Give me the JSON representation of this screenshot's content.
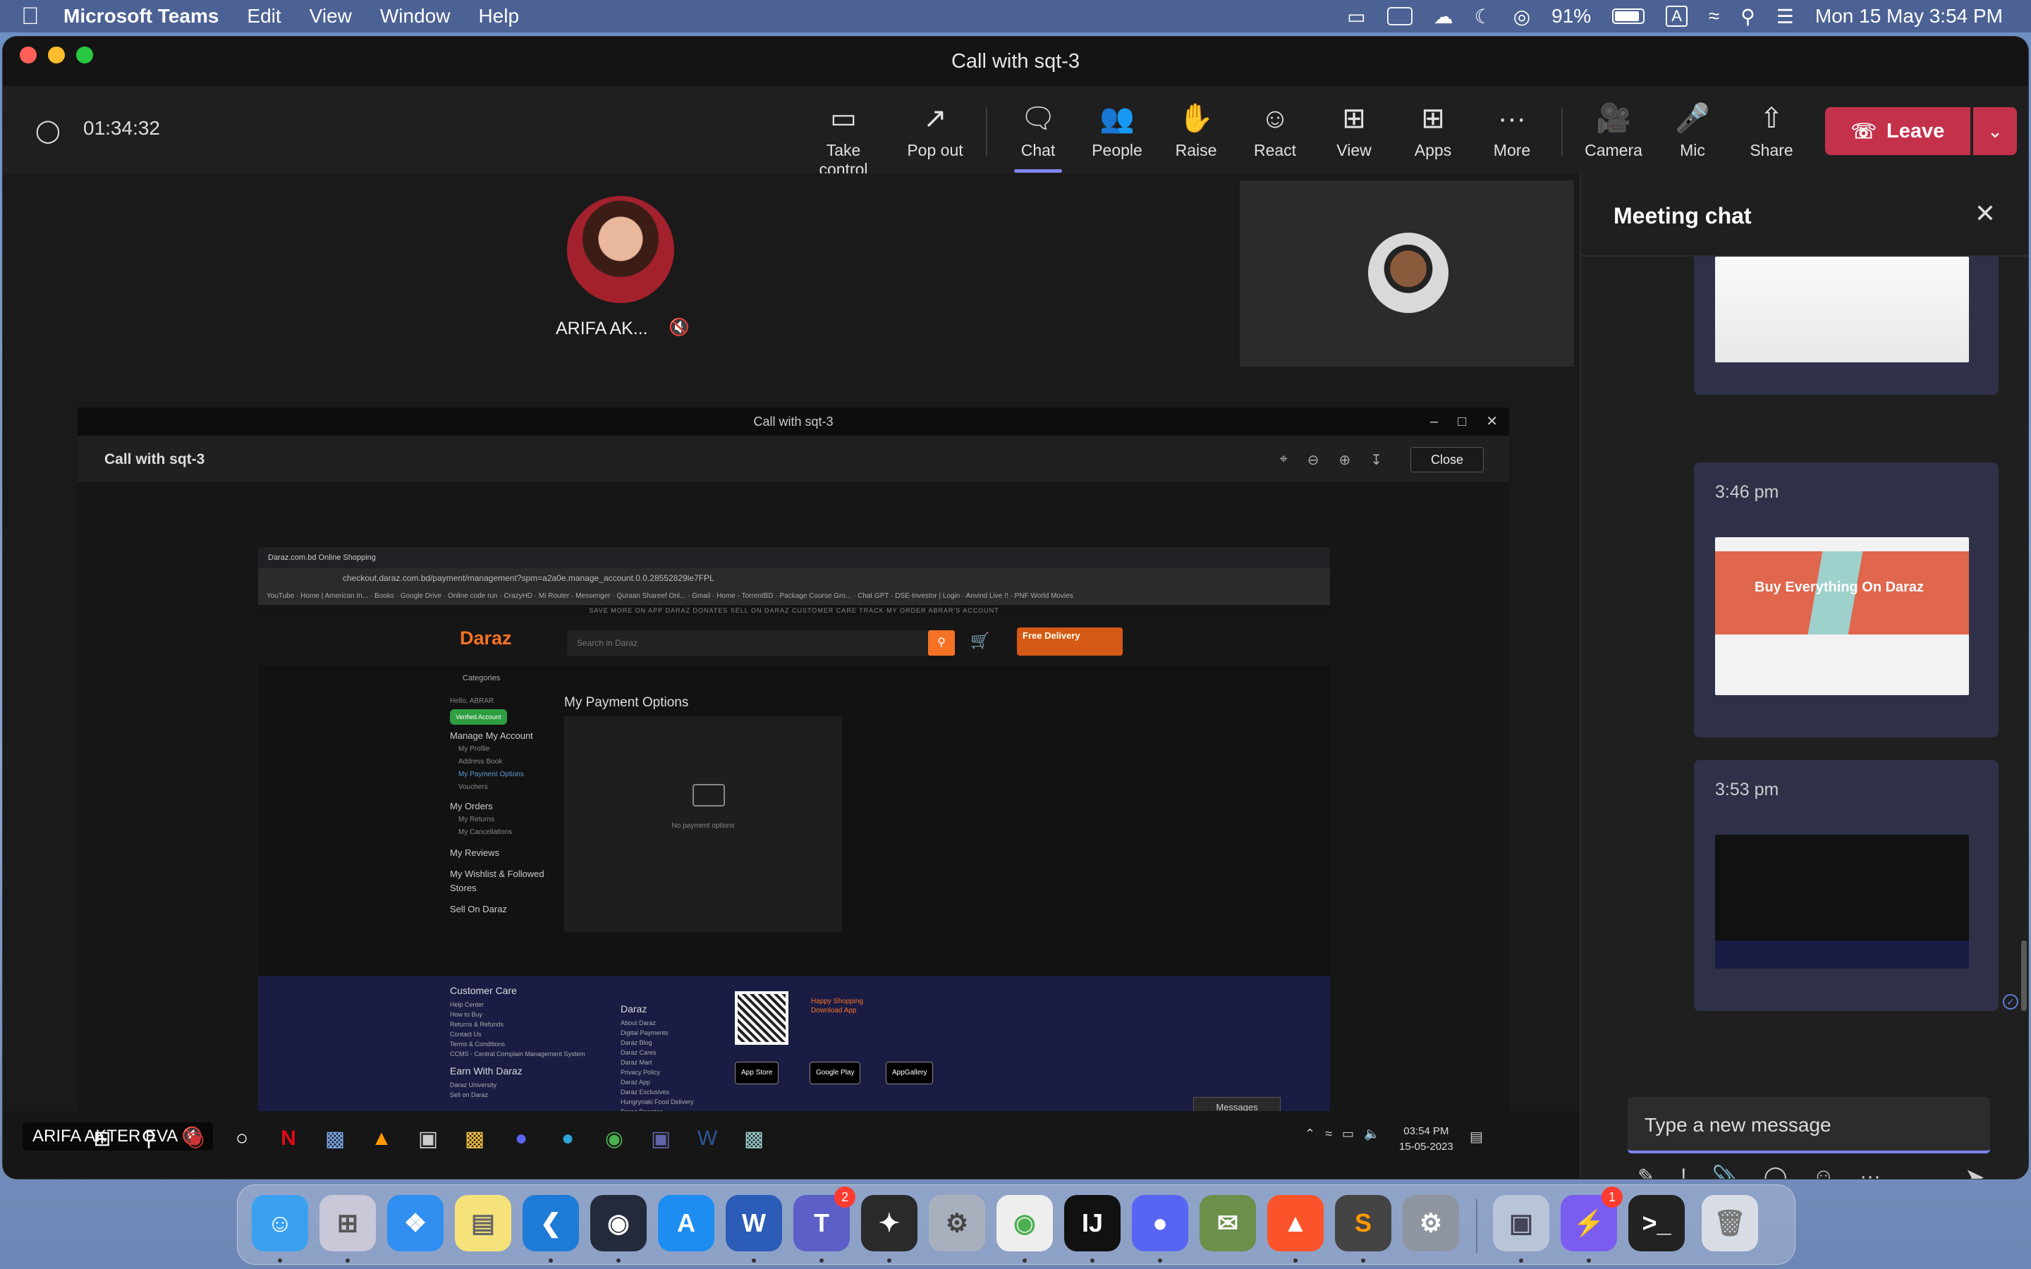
{
  "menubar": {
    "app_name": "Microsoft Teams",
    "menus": [
      "Edit",
      "View",
      "Window",
      "Help"
    ],
    "battery": "91%",
    "datetime": "Mon 15 May  3:54 PM"
  },
  "window": {
    "title": "Call with sqt-3",
    "timer": "01:34:32"
  },
  "toolbar": {
    "take_control": "Take control",
    "pop_out": "Pop out",
    "chat": "Chat",
    "people": "People",
    "raise": "Raise",
    "react": "React",
    "view": "View",
    "apps": "Apps",
    "more": "More",
    "camera": "Camera",
    "mic": "Mic",
    "share": "Share",
    "leave": "Leave"
  },
  "participants": {
    "p1_name": "ARIFA AK...",
    "presenter_name": "ARIFA AKTER EVA"
  },
  "shared_screen": {
    "window_title": "Call with sqt-3",
    "viewer_title": "Call with sqt-3",
    "close_label": "Close",
    "caption": "image",
    "browser": {
      "tab": "Daraz.com.bd Online Shopping",
      "url": "checkout.daraz.com.bd/payment/management?spm=a2a0e.manage_account.0.0.28552829le7FPL",
      "bookmarks": "YouTube · Home | American In... · Books · Google Drive · Online code run · CrazyHD · Mi Router · Messenger · Quraan Shareef Onl... · Gmail · Home - TorrentBD · Package Course Gro... · Chat GPT · DSE-Investor | Login · Anvind Live !! · PNF World Movies",
      "topstrip": "SAVE MORE ON APP   DARAZ DONATES   SELL ON DARAZ   CUSTOMER CARE   TRACK MY ORDER   ABRAR'S ACCOUNT",
      "logo": "Daraz",
      "search_placeholder": "Search in Daraz",
      "banner": "Free Delivery",
      "categories": "Categories",
      "hello": "Hello, ABRAR",
      "verified": "Verified Account",
      "manage": "Manage My Account",
      "my_profile": "My Profile",
      "address_book": "Address Book",
      "my_payment_options": "My Payment Options",
      "vouchers": "Vouchers",
      "my_orders": "My Orders",
      "my_returns": "My Returns",
      "my_cancellations": "My Cancellations",
      "my_reviews": "My Reviews",
      "wishlist": "My Wishlist & Followed Stores",
      "sell": "Sell On Daraz",
      "page_title": "My Payment Options",
      "empty": "No payment options",
      "footer_cc": "Customer Care",
      "footer_cc_items": "Help Center\nHow to Buy\nReturns & Refunds\nContact Us\nTerms & Conditions\nCCMS - Central Complain Management System",
      "footer_earn": "Earn With Daraz",
      "footer_earn_items": "Daraz University\nSell on Daraz",
      "footer_daraz": "Daraz",
      "footer_daraz_items": "About Daraz\nDigital Payments\nDaraz Blog\nDaraz Cares\nDaraz Mart\nPrivacy Policy\nDaraz App\nDaraz Exclusives\nHungrynaki Food Delivery\nDaraz Donates",
      "happy": "Happy Shopping\nDownload App",
      "app_store": "App Store",
      "google_play": "Google Play",
      "app_gallery": "AppGallery",
      "messages": "Messages"
    },
    "taskbar_time": "03:54 PM",
    "taskbar_date": "15-05-2023"
  },
  "chat": {
    "title": "Meeting chat",
    "messages": [
      {
        "time": ""
      },
      {
        "time": "3:46 pm",
        "banner": "Buy Everything On Daraz"
      },
      {
        "time": "3:53 pm"
      }
    ],
    "compose_placeholder": "Type a new message"
  },
  "dock": {
    "teams_badge": "2",
    "messenger_badge": "1"
  },
  "colors": {
    "leave": "#c4314b",
    "accent": "#7f85f5",
    "daraz": "#f57224"
  }
}
